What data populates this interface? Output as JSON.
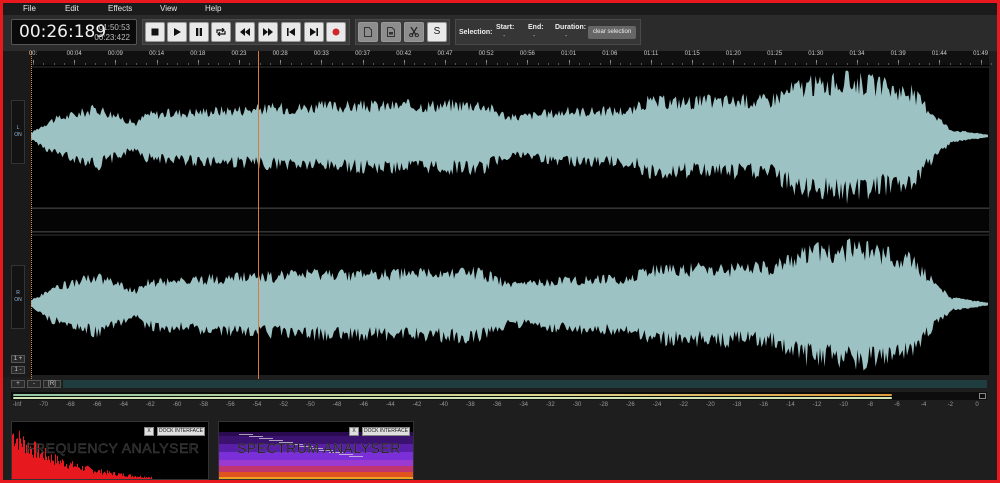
{
  "menu": [
    "File",
    "Edit",
    "Effects",
    "View",
    "Help"
  ],
  "clock": {
    "current": "00:26:189",
    "total": "01:50:53",
    "secondary": "00:23:422"
  },
  "transport": {
    "stop": "stop-icon",
    "play": "play-icon",
    "pause": "pause-icon",
    "loop": "loop-icon",
    "rewind": "rewind-icon",
    "forward": "fast-forward-icon",
    "skip_start": "skip-start-icon",
    "skip_end": "skip-end-icon",
    "record": "record-icon"
  },
  "edit_tools": {
    "new": "file-icon",
    "save": "save-file-icon",
    "cut": "scissors-icon",
    "solo_label": "S"
  },
  "selection": {
    "label": "Selection:",
    "start_label": "Start:",
    "start_value": "-",
    "end_label": "End:",
    "end_value": "-",
    "duration_label": "Duration:",
    "duration_value": "-",
    "clear_label": "clear selection"
  },
  "timeline": [
    "00:",
    "00:04",
    "00:09",
    "00:14",
    "00:18",
    "00:23",
    "00:28",
    "00:33",
    "00:37",
    "00:42",
    "00:47",
    "00:52",
    "00:56",
    "01:01",
    "01:06",
    "01:11",
    "01:15",
    "01:20",
    "01:25",
    "01:30",
    "01:34",
    "01:39",
    "01:44",
    "01:49"
  ],
  "channels": [
    {
      "name": "L",
      "state": "ON"
    },
    {
      "name": "R",
      "state": "ON"
    }
  ],
  "track_controls": [
    "1 +",
    "1 -"
  ],
  "zoom": {
    "plus": "+",
    "minus": "-",
    "reset": "[R]"
  },
  "playhead_seconds": 26.189,
  "duration_seconds": 110.53,
  "colors": {
    "waveform": "#9cc2c4",
    "playhead": "#d97b3e",
    "meter_left": "#e09a3a",
    "meter_right": "#cfe6b4",
    "accent_frame": "#e8191e"
  },
  "meter": {
    "scale": [
      "-Inf",
      "-70",
      "-68",
      "-66",
      "-64",
      "-62",
      "-60",
      "-58",
      "-56",
      "-54",
      "-52",
      "-50",
      "-48",
      "-46",
      "-44",
      "-42",
      "-40",
      "-38",
      "-36",
      "-34",
      "-32",
      "-30",
      "-28",
      "-26",
      "-24",
      "-22",
      "-20",
      "-18",
      "-16",
      "-14",
      "-12",
      "-10",
      "-8",
      "-6",
      "-4",
      "-2",
      "0"
    ],
    "left_level": 0.91,
    "right_level": 0.91
  },
  "panels": [
    {
      "title": "FREQUENCY ANALYSER",
      "close": "X",
      "dock": "DOCK INTERFACE"
    },
    {
      "title": "SPECTRUM ANALYSER",
      "close": "X",
      "dock": "DOCK INTERFACE"
    }
  ]
}
